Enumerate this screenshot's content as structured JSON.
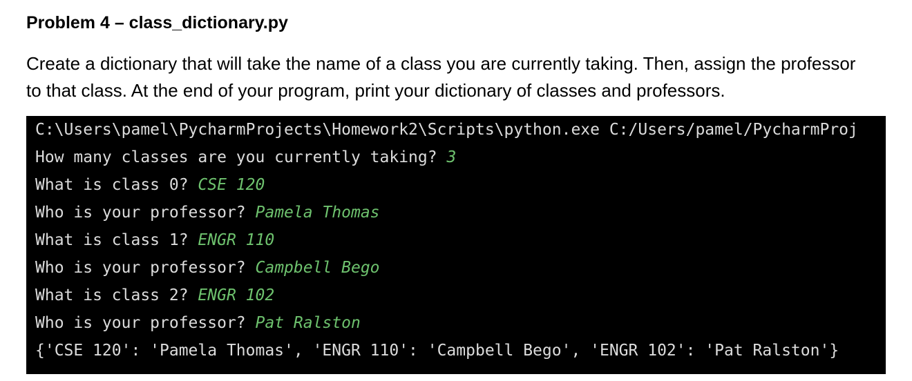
{
  "document": {
    "heading": "Problem 4 – class_dictionary.py",
    "instructions": [
      "Create a dictionary that will take the name of a class you are currently taking.  Then, assign the professor",
      "to that class.  At the end of your program, print your dictionary of classes and professors."
    ]
  },
  "terminal": {
    "command_line": "C:\\Users\\pamel\\PycharmProjects\\Homework2\\Scripts\\python.exe C:/Users/pamel/PycharmProj",
    "lines": [
      {
        "prompt": "How many classes are you currently taking? ",
        "input": "3"
      },
      {
        "prompt": "What is class 0? ",
        "input": "CSE 120"
      },
      {
        "prompt": "Who is your professor? ",
        "input": "Pamela Thomas"
      },
      {
        "prompt": "What is class 1? ",
        "input": "ENGR 110"
      },
      {
        "prompt": "Who is your professor? ",
        "input": "Campbell Bego"
      },
      {
        "prompt": "What is class 2? ",
        "input": "ENGR 102"
      },
      {
        "prompt": "Who is your professor? ",
        "input": "Pat Ralston"
      }
    ],
    "output": "{'CSE 120': 'Pamela Thomas', 'ENGR 110': 'Campbell Bego', 'ENGR 102': 'Pat Ralston'}"
  },
  "colors": {
    "page_background": "#ffffff",
    "terminal_background": "#000000",
    "terminal_text": "#dcdcdc",
    "user_input": "#6ec26e"
  }
}
